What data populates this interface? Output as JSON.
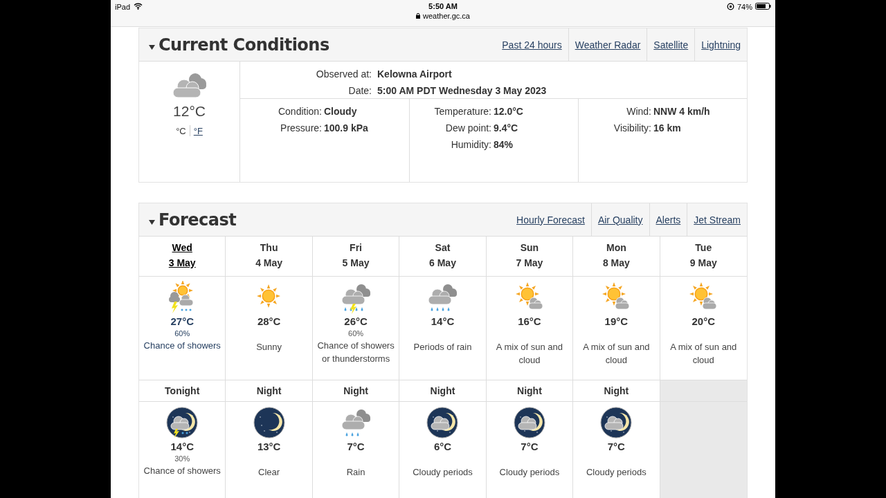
{
  "status_bar": {
    "device": "iPad",
    "time": "5:50 AM",
    "url": "weather.gc.ca",
    "battery": "74%"
  },
  "current": {
    "title": "Current Conditions",
    "links": [
      "Past 24 hours",
      "Weather Radar",
      "Satellite",
      "Lightning"
    ],
    "temperature": "12°C",
    "units": [
      {
        "label": "°C",
        "selected": true
      },
      {
        "label": "°F",
        "selected": false
      }
    ],
    "observed_label": "Observed at:",
    "observed": "Kelowna Airport",
    "date_label": "Date:",
    "date": "5:00 AM PDT Wednesday 3 May 2023",
    "columns": [
      [
        {
          "label": "Condition:",
          "value": "Cloudy"
        },
        {
          "label": "Pressure:",
          "value": "100.9 kPa"
        }
      ],
      [
        {
          "label": "Temperature:",
          "value": "12.0°C"
        },
        {
          "label": "Dew point:",
          "value": "9.4°C"
        },
        {
          "label": "Humidity:",
          "value": "84%"
        }
      ],
      [
        {
          "label": "Wind:",
          "value": "NNW 4 km/h"
        },
        {
          "label": "Visibility:",
          "value": "16 km"
        }
      ]
    ]
  },
  "forecast": {
    "title": "Forecast",
    "links": [
      "Hourly Forecast",
      "Air Quality",
      "Alerts",
      "Jet Stream"
    ],
    "days": [
      {
        "day": "Wed",
        "date": "3 May",
        "selected": true,
        "kind": "storm",
        "temp": "27°C",
        "pop": "60%",
        "summary": "Chance of showers"
      },
      {
        "day": "Thu",
        "date": "4 May",
        "selected": false,
        "kind": "sun",
        "temp": "28°C",
        "summary": "Sunny"
      },
      {
        "day": "Fri",
        "date": "5 May",
        "selected": false,
        "kind": "stormrain",
        "temp": "26°C",
        "pop": "60%",
        "summary": "Chance of showers or thunderstorms"
      },
      {
        "day": "Sat",
        "date": "6 May",
        "selected": false,
        "kind": "rain",
        "temp": "14°C",
        "summary": "Periods of rain"
      },
      {
        "day": "Sun",
        "date": "7 May",
        "selected": false,
        "kind": "suncloud",
        "temp": "16°C",
        "summary": "A mix of sun and cloud"
      },
      {
        "day": "Mon",
        "date": "8 May",
        "selected": false,
        "kind": "suncloud",
        "temp": "19°C",
        "summary": "A mix of sun and cloud"
      },
      {
        "day": "Tue",
        "date": "9 May",
        "selected": false,
        "kind": "suncloud",
        "temp": "20°C",
        "summary": "A mix of sun and cloud"
      }
    ],
    "nights": [
      {
        "label": "Tonight",
        "kind": "nightstorm",
        "temp": "14°C",
        "pop": "30%",
        "summary": "Chance of showers"
      },
      {
        "label": "Night",
        "kind": "clear",
        "temp": "13°C",
        "summary": "Clear"
      },
      {
        "label": "Night",
        "kind": "rain",
        "temp": "7°C",
        "summary": "Rain"
      },
      {
        "label": "Night",
        "kind": "nightcloud",
        "temp": "6°C",
        "summary": "Cloudy periods"
      },
      {
        "label": "Night",
        "kind": "nightcloud",
        "temp": "7°C",
        "summary": "Cloudy periods"
      },
      {
        "label": "Night",
        "kind": "nightcloud",
        "temp": "7°C",
        "summary": "Cloudy periods"
      }
    ]
  }
}
